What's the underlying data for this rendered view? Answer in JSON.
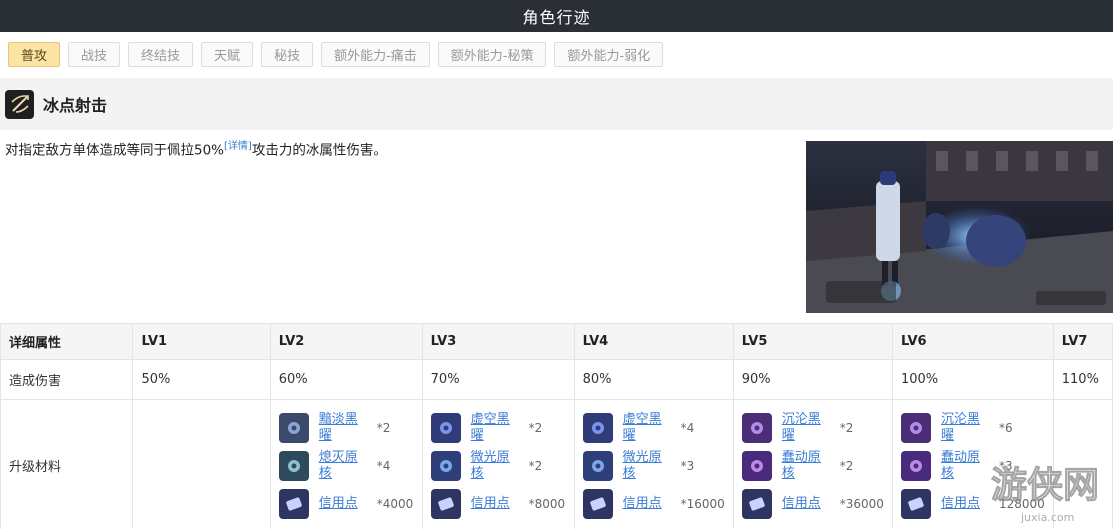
{
  "page_title": "角色行迹",
  "tabs": [
    "普攻",
    "战技",
    "终结技",
    "天赋",
    "秘技",
    "额外能力-痛击",
    "额外能力-秘策",
    "额外能力-弱化"
  ],
  "active_tab": 0,
  "skill": {
    "name": "冰点射击",
    "desc_before": "对指定敌方单体造成等同于佩拉50%",
    "desc_link": "[详情]",
    "desc_after": "攻击力的冰属性伤害。"
  },
  "table": {
    "header_label": "详细属性",
    "levels": [
      "LV1",
      "LV2",
      "LV3",
      "LV4",
      "LV5",
      "LV6",
      "LV7"
    ],
    "damage_label": "造成伤害",
    "damage": [
      "50%",
      "60%",
      "70%",
      "80%",
      "90%",
      "100%",
      "110%"
    ],
    "materials_label": "升级材料",
    "materials": [
      [],
      [
        {
          "name": "黯淡黑曜",
          "count": "*2",
          "icon": "dark-obsidian-icon"
        },
        {
          "name": "熄灭原核",
          "count": "*4",
          "icon": "extinguished-core-icon"
        },
        {
          "name": "信用点",
          "count": "*4000",
          "icon": "credit-icon"
        }
      ],
      [
        {
          "name": "虚空黑曜",
          "count": "*2",
          "icon": "void-obsidian-icon"
        },
        {
          "name": "微光原核",
          "count": "*2",
          "icon": "glimmer-core-icon"
        },
        {
          "name": "信用点",
          "count": "*8000",
          "icon": "credit-icon"
        }
      ],
      [
        {
          "name": "虚空黑曜",
          "count": "*4",
          "icon": "void-obsidian-icon"
        },
        {
          "name": "微光原核",
          "count": "*3",
          "icon": "glimmer-core-icon"
        },
        {
          "name": "信用点",
          "count": "*16000",
          "icon": "credit-icon"
        }
      ],
      [
        {
          "name": "沉沦黑曜",
          "count": "*2",
          "icon": "sunken-obsidian-icon"
        },
        {
          "name": "蠢动原核",
          "count": "*2",
          "icon": "squirming-core-icon"
        },
        {
          "name": "信用点",
          "count": "*36000",
          "icon": "credit-icon"
        }
      ],
      [
        {
          "name": "沉沦黑曜",
          "count": "*6",
          "icon": "sunken-obsidian-icon"
        },
        {
          "name": "蠢动原核",
          "count": "*3",
          "icon": "squirming-core-icon"
        },
        {
          "name": "信用点",
          "count": "128000",
          "icon": "credit-icon"
        }
      ],
      []
    ]
  },
  "watermark": "游侠网",
  "colors": {
    "title_bar": "#2a2f36",
    "active_tab": "#fbe4a5",
    "link": "#3a7bd5"
  }
}
